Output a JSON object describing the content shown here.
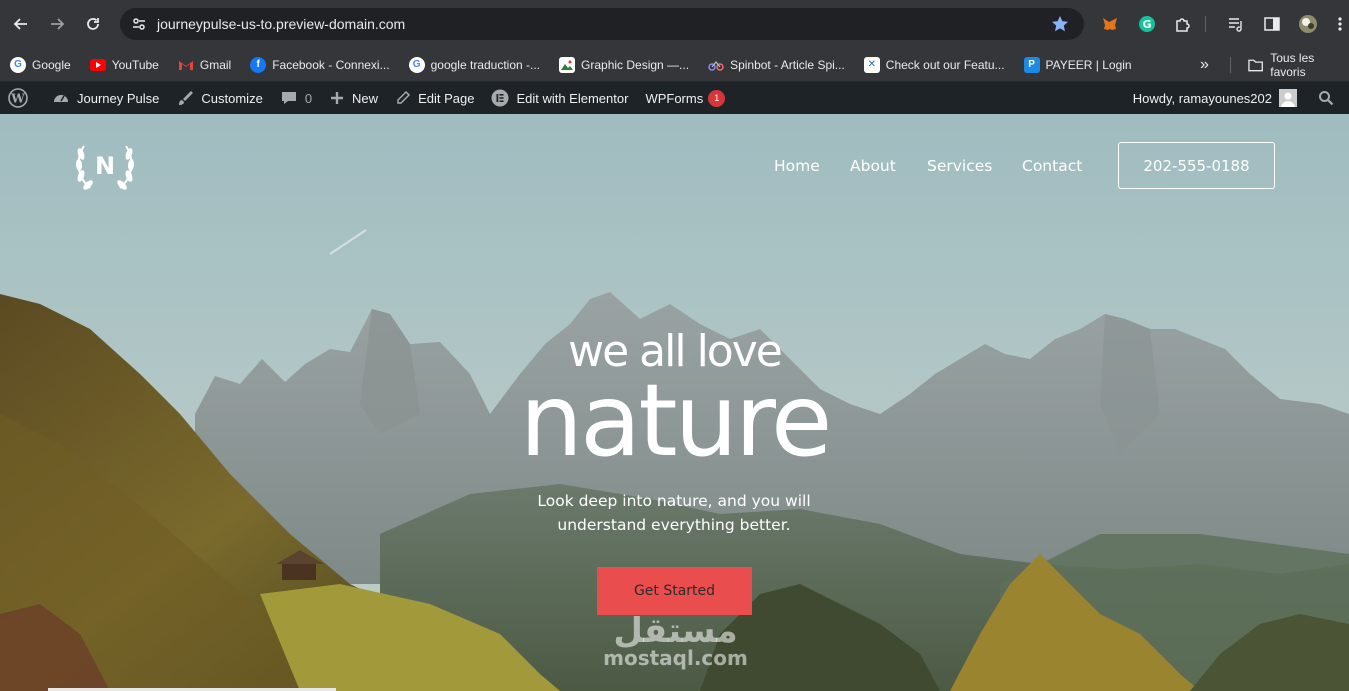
{
  "browser": {
    "url": "journeypulse-us-to.preview-domain.com",
    "bookmarks": [
      {
        "label": "Google",
        "icon": "google-icon",
        "color": "#4285f4"
      },
      {
        "label": "YouTube",
        "icon": "youtube-icon",
        "color": "#ff0000"
      },
      {
        "label": "Gmail",
        "icon": "gmail-icon",
        "color": "#ea4335"
      },
      {
        "label": "Facebook - Connexi...",
        "icon": "facebook-icon",
        "color": "#1877f2"
      },
      {
        "label": "google traduction -...",
        "icon": "google-icon",
        "color": "#4285f4"
      },
      {
        "label": "Graphic Design —...",
        "icon": "image-icon",
        "color": "#ffffff"
      },
      {
        "label": "Spinbot - Article Spi...",
        "icon": "spinbot-icon",
        "color": "#6c6cff"
      },
      {
        "label": "Check out our Featu...",
        "icon": "x-icon",
        "color": "#ffffff"
      },
      {
        "label": "PAYEER | Login",
        "icon": "payeer-icon",
        "color": "#1e88e5"
      }
    ],
    "more_bookmarks": "»",
    "all_bookmarks": "Tous les favoris"
  },
  "wp_admin": {
    "site_name": "Journey Pulse",
    "customize": "Customize",
    "comments_count": "0",
    "new": "New",
    "edit_page": "Edit Page",
    "elementor": "Edit with Elementor",
    "wpforms": "WPForms",
    "wpforms_badge": "1",
    "howdy": "Howdy, ramayounes202"
  },
  "site": {
    "logo_letter": "N",
    "menu": [
      "Home",
      "About",
      "Services",
      "Contact"
    ],
    "phone": "202-555-0188",
    "hero_small": "we all love",
    "hero_big": "nature",
    "subtitle_line1": "Look deep into nature, and you will",
    "subtitle_line2": "understand everything better.",
    "cta": "Get Started",
    "cta_color": "#ea4d4d",
    "watermark_arabic": "مستقل",
    "watermark_latin": "mostaql.com"
  }
}
